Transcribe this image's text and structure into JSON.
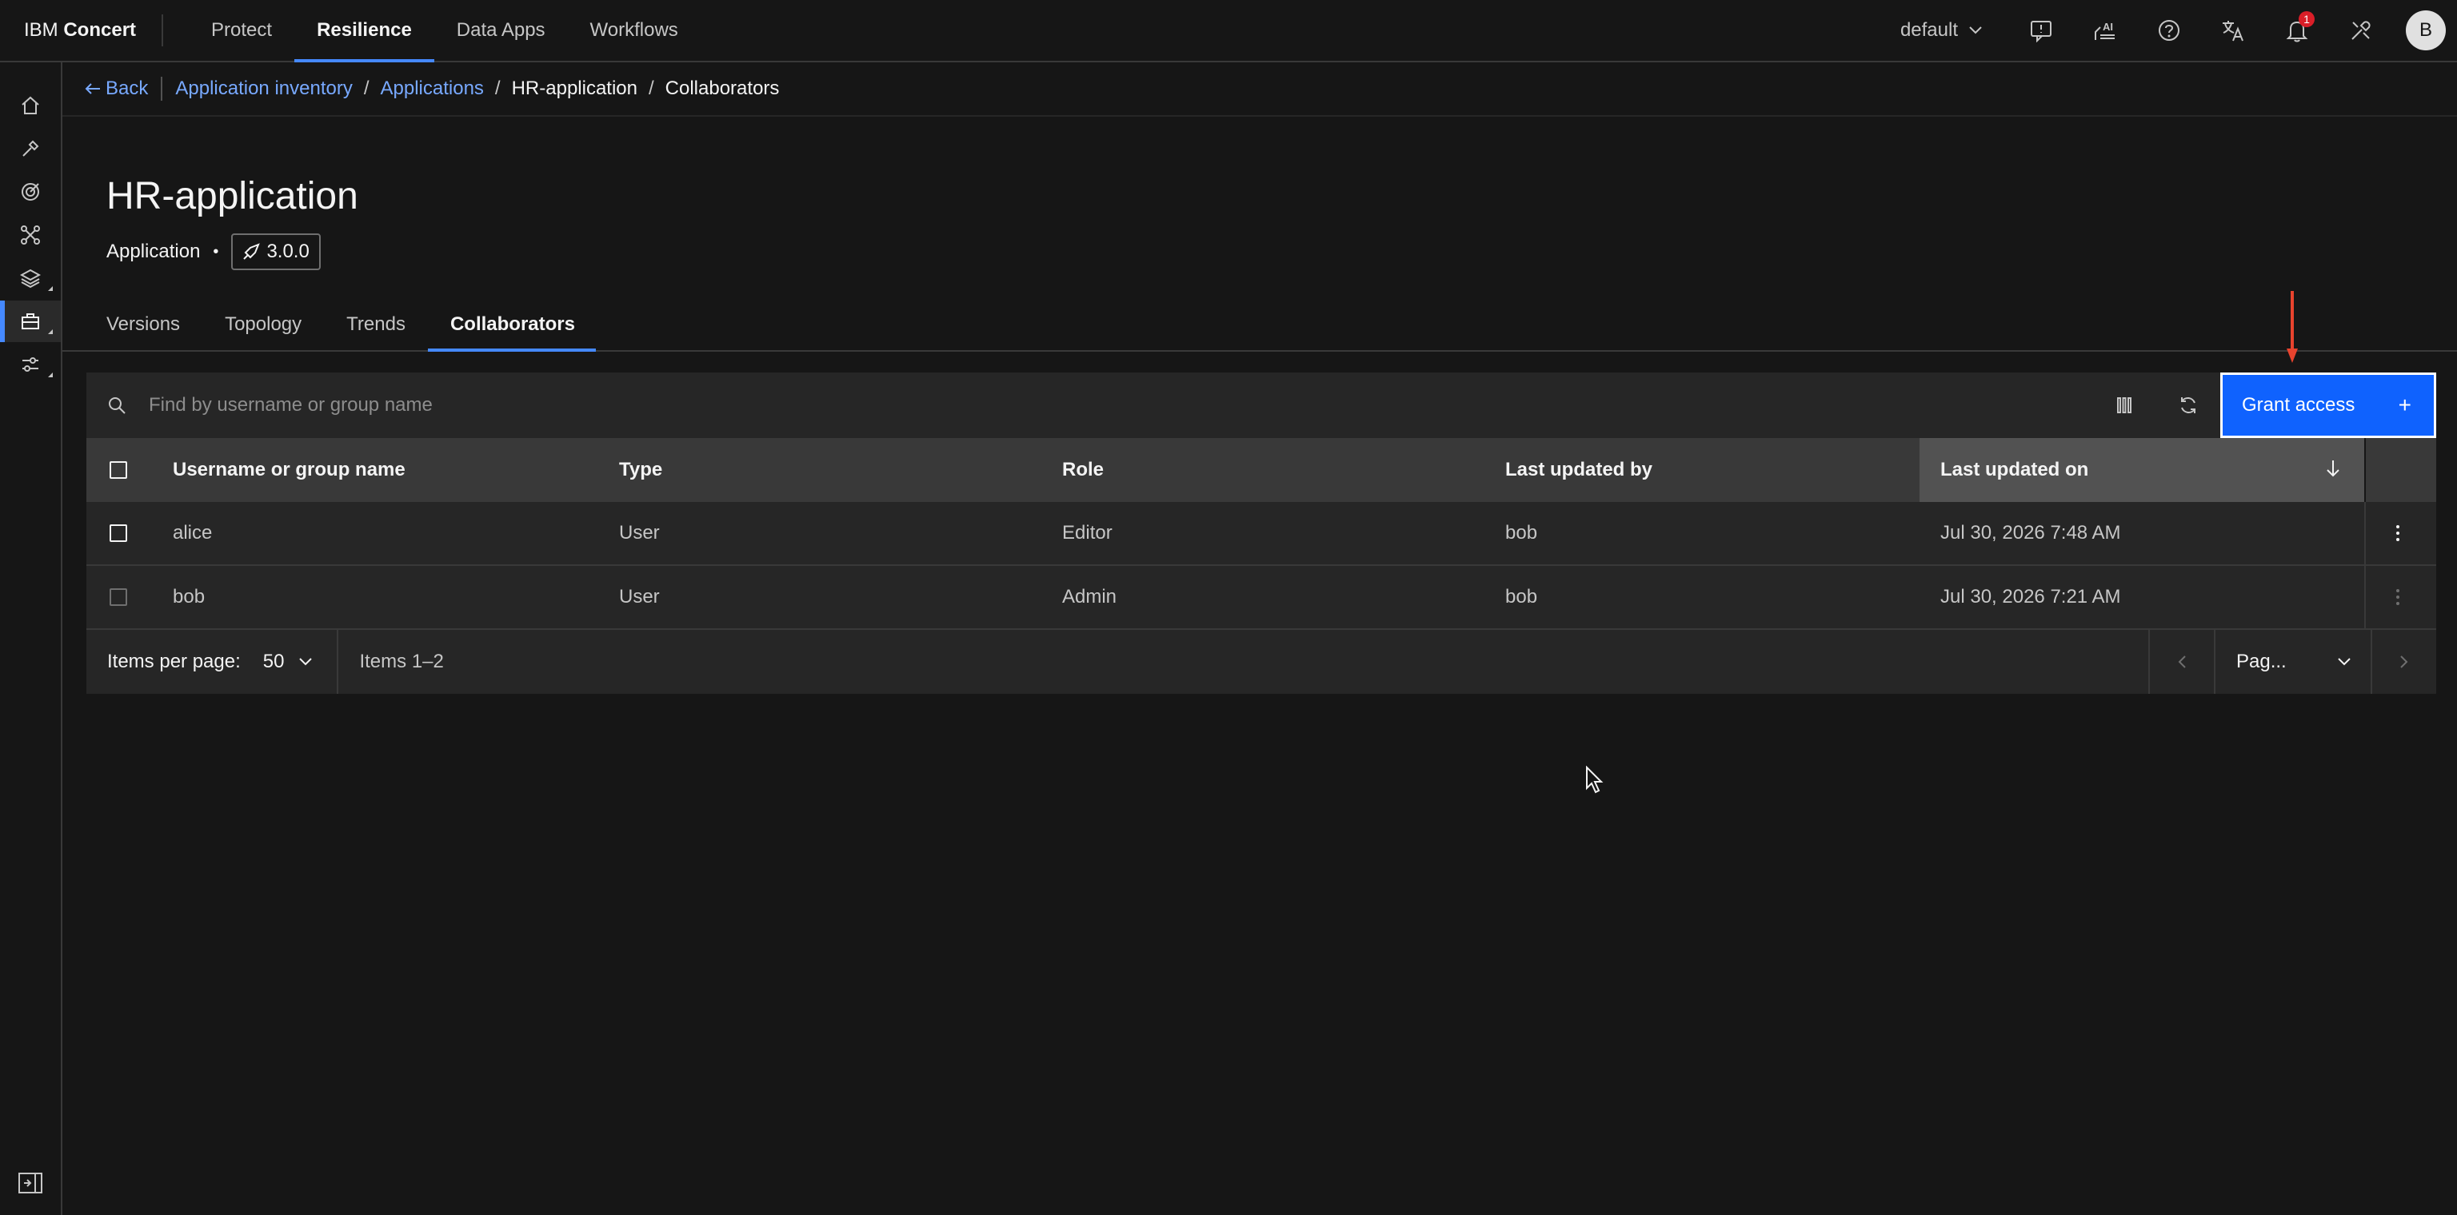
{
  "header": {
    "brand_light": "IBM",
    "brand_bold": "Concert",
    "nav": [
      "Protect",
      "Resilience",
      "Data Apps",
      "Workflows"
    ],
    "active_nav": "Resilience",
    "tenant": "default",
    "notification_count": "1",
    "avatar_initial": "B",
    "icons": [
      "feedback-icon",
      "ai-icon",
      "help-icon",
      "translate-icon",
      "notification-icon",
      "tools-icon"
    ]
  },
  "rail": {
    "icons": [
      "home-icon",
      "tools-icon",
      "target-icon",
      "network-icon",
      "layers-icon",
      "inventory-icon",
      "settings-sliders-icon"
    ],
    "active": "inventory-icon",
    "bottom_icon": "expand-panel-icon"
  },
  "breadcrumb": {
    "back": "Back",
    "items": [
      "Application inventory",
      "Applications",
      "HR-application",
      "Collaborators"
    ]
  },
  "page": {
    "title": "HR-application",
    "type": "Application",
    "version": "3.0.0"
  },
  "tabs": [
    "Versions",
    "Topology",
    "Trends",
    "Collaborators"
  ],
  "active_tab": "Collaborators",
  "toolbar": {
    "search_placeholder": "Find by username or group name",
    "grant_label": "Grant access",
    "grant_plus": "+"
  },
  "table": {
    "headers": [
      "Username or group name",
      "Type",
      "Role",
      "Last updated by",
      "Last updated on"
    ],
    "sorted_column": "Last updated on",
    "rows": [
      {
        "name": "alice",
        "type": "User",
        "role": "Editor",
        "by": "bob",
        "on": "Jul 30, 2026 7:48 AM"
      },
      {
        "name": "bob",
        "type": "User",
        "role": "Admin",
        "by": "bob",
        "on": "Jul 30, 2026 7:21 AM"
      }
    ]
  },
  "pagination": {
    "items_per_page_label": "Items per page:",
    "items_per_page": "50",
    "range": "Items 1–2",
    "page_label": "Pag..."
  },
  "colors": {
    "accent": "#4589ff",
    "primary_button": "#0f62fe",
    "annotation_arrow": "#e8432e",
    "background": "#161616"
  }
}
